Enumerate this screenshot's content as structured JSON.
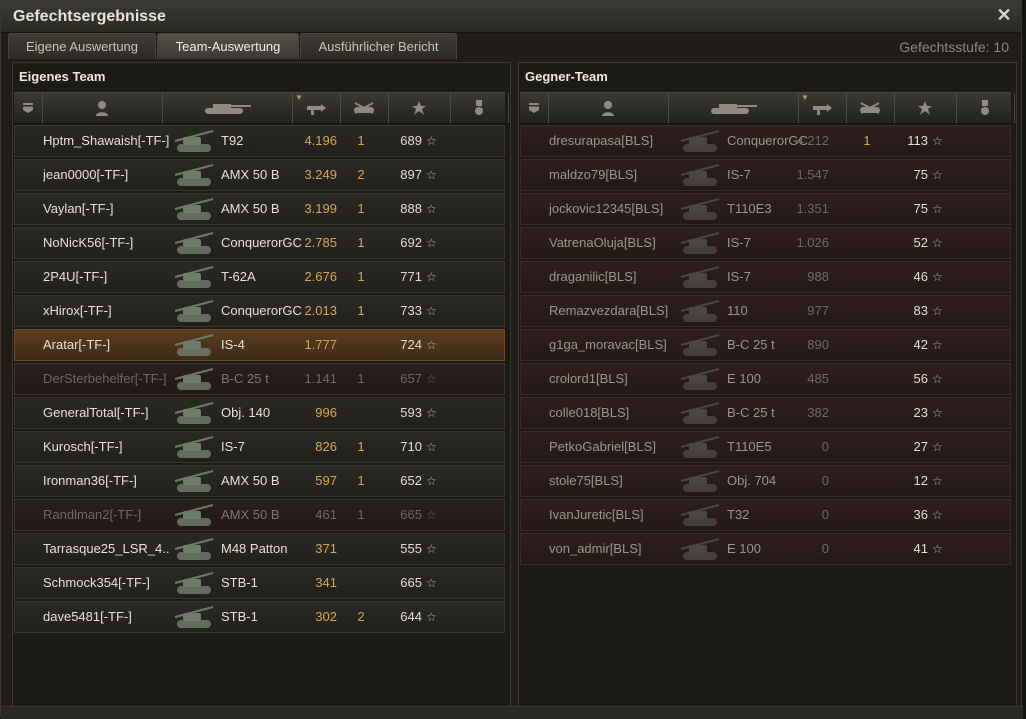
{
  "window": {
    "title": "Gefechtsergebnisse",
    "close_icon": "close-icon"
  },
  "tabs": [
    {
      "label": "Eigene Auswertung",
      "active": false
    },
    {
      "label": "Team-Auswertung",
      "active": true
    },
    {
      "label": "Ausführlicher Bericht",
      "active": false
    }
  ],
  "battle_tier": "Gefechtsstufe: 10",
  "columns": [
    "squad-icon",
    "player-icon",
    "tank-icon",
    "damage-icon",
    "kills-icon",
    "xp-star-icon",
    "medal-icon"
  ],
  "own_team": {
    "title": "Eigenes Team",
    "players": [
      {
        "player": "Hptm_Shawaish[-TF-]",
        "tank": "T92",
        "damage": "4.196",
        "kills": "1",
        "xp": "689",
        "state": "alive"
      },
      {
        "player": "jean0000[-TF-]",
        "tank": "AMX 50 B",
        "damage": "3.249",
        "kills": "2",
        "xp": "897",
        "state": "alive"
      },
      {
        "player": "Vaylan[-TF-]",
        "tank": "AMX 50 B",
        "damage": "3.199",
        "kills": "1",
        "xp": "888",
        "state": "alive"
      },
      {
        "player": "NoNicK56[-TF-]",
        "tank": "ConquerorGC",
        "damage": "2.785",
        "kills": "1",
        "xp": "692",
        "state": "alive"
      },
      {
        "player": "2P4U[-TF-]",
        "tank": "T-62A",
        "damage": "2.676",
        "kills": "1",
        "xp": "771",
        "state": "alive"
      },
      {
        "player": "xHirox[-TF-]",
        "tank": "ConquerorGC",
        "damage": "2.013",
        "kills": "1",
        "xp": "733",
        "state": "alive"
      },
      {
        "player": "Aratar[-TF-]",
        "tank": "IS-4",
        "damage": "1.777",
        "kills": "",
        "xp": "724",
        "state": "self"
      },
      {
        "player": "DerSterbehelfer[-TF-]",
        "tank": "B-C 25 t",
        "damage": "1.141",
        "kills": "1",
        "xp": "657",
        "state": "dead"
      },
      {
        "player": "GeneralTotal[-TF-]",
        "tank": "Obj. 140",
        "damage": "996",
        "kills": "",
        "xp": "593",
        "state": "alive"
      },
      {
        "player": "Kurosch[-TF-]",
        "tank": "IS-7",
        "damage": "826",
        "kills": "1",
        "xp": "710",
        "state": "alive"
      },
      {
        "player": "Ironman36[-TF-]",
        "tank": "AMX 50 B",
        "damage": "597",
        "kills": "1",
        "xp": "652",
        "state": "alive"
      },
      {
        "player": "Randlman2[-TF-]",
        "tank": "AMX 50 B",
        "damage": "461",
        "kills": "1",
        "xp": "665",
        "state": "dead"
      },
      {
        "player": "Tarrasque25_LSR_4..",
        "tank": "M48 Patton",
        "damage": "371",
        "kills": "",
        "xp": "555",
        "state": "alive"
      },
      {
        "player": "Schmock354[-TF-]",
        "tank": "STB-1",
        "damage": "341",
        "kills": "",
        "xp": "665",
        "state": "alive"
      },
      {
        "player": "dave5481[-TF-]",
        "tank": "STB-1",
        "damage": "302",
        "kills": "2",
        "xp": "644",
        "state": "alive"
      }
    ]
  },
  "enemy_team": {
    "title": "Gegner-Team",
    "players": [
      {
        "player": "dresurapasa[BLS]",
        "tank": "ConquerorGC",
        "damage": "4.212",
        "kills": "1",
        "xp": "113",
        "state": "dead"
      },
      {
        "player": "maldzo79[BLS]",
        "tank": "IS-7",
        "damage": "1.547",
        "kills": "",
        "xp": "75",
        "state": "dead"
      },
      {
        "player": "jockovic12345[BLS]",
        "tank": "T110E3",
        "damage": "1.351",
        "kills": "",
        "xp": "75",
        "state": "dead"
      },
      {
        "player": "VatrenaOluja[BLS]",
        "tank": "IS-7",
        "damage": "1.026",
        "kills": "",
        "xp": "52",
        "state": "dead"
      },
      {
        "player": "draganilic[BLS]",
        "tank": "IS-7",
        "damage": "988",
        "kills": "",
        "xp": "46",
        "state": "dead"
      },
      {
        "player": "Remazvezdara[BLS]",
        "tank": "110",
        "damage": "977",
        "kills": "",
        "xp": "83",
        "state": "dead"
      },
      {
        "player": "g1ga_moravac[BLS]",
        "tank": "B-C 25 t",
        "damage": "890",
        "kills": "",
        "xp": "42",
        "state": "dead"
      },
      {
        "player": "crolord1[BLS]",
        "tank": "E 100",
        "damage": "485",
        "kills": "",
        "xp": "56",
        "state": "dead"
      },
      {
        "player": "colle018[BLS]",
        "tank": "B-C 25 t",
        "damage": "382",
        "kills": "",
        "xp": "23",
        "state": "dead"
      },
      {
        "player": "PetkoGabriel[BLS]",
        "tank": "T110E5",
        "damage": "0",
        "kills": "",
        "xp": "27",
        "state": "dead"
      },
      {
        "player": "stole75[BLS]",
        "tank": "Obj. 704",
        "damage": "0",
        "kills": "",
        "xp": "12",
        "state": "dead"
      },
      {
        "player": "IvanJuretic[BLS]",
        "tank": "T32",
        "damage": "0",
        "kills": "",
        "xp": "36",
        "state": "dead"
      },
      {
        "player": "von_admir[BLS]",
        "tank": "E 100",
        "damage": "0",
        "kills": "",
        "xp": "41",
        "state": "dead"
      }
    ]
  },
  "colors": {
    "damage": "#d7a64d",
    "self_row": "#5a3d1f",
    "dead_row": "#2a1f1d"
  }
}
